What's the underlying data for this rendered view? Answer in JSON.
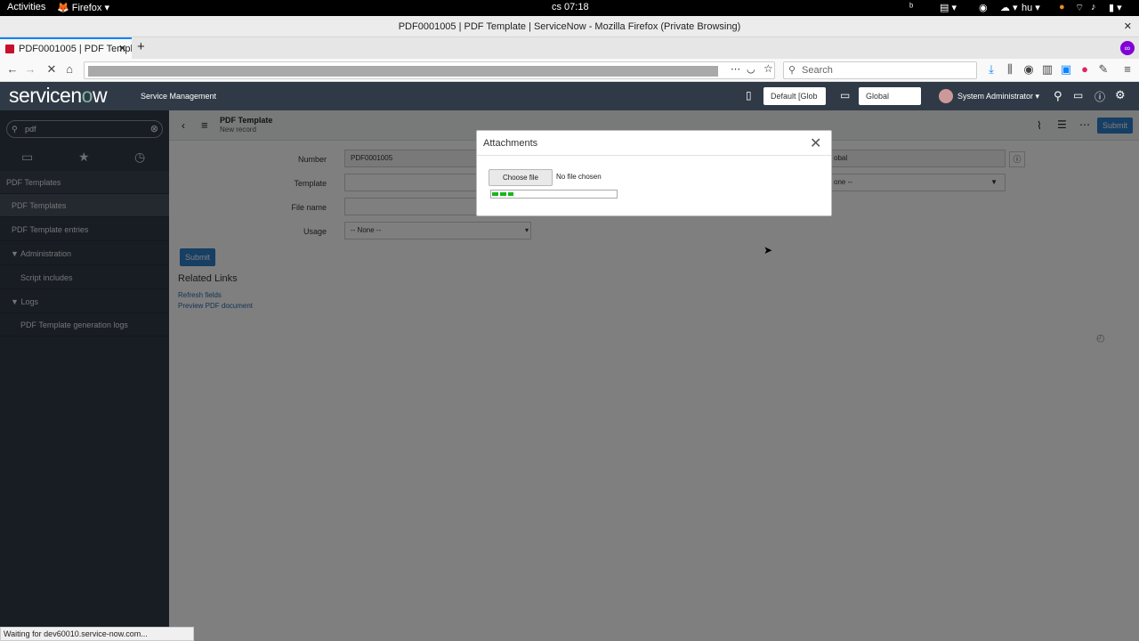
{
  "gnome": {
    "activities": "Activities",
    "app": "Firefox",
    "time": "cs 07:18",
    "lang": "hu"
  },
  "firefox": {
    "window_title": "PDF0001005 | PDF Template | ServiceNow - Mozilla Firefox (Private Browsing)",
    "tab_title": "PDF0001005 | PDF Templ",
    "search_placeholder": "Search",
    "status_text": "Waiting for dev60010.service-now.com..."
  },
  "sn_header": {
    "logo_text_a": "servicen",
    "logo_text_o": "o",
    "logo_text_b": "w",
    "subtitle": "Service Management",
    "update_set": "Default [Glob",
    "scope": "Global",
    "user": "System Administrator"
  },
  "sidebar": {
    "filter_value": "pdf",
    "section_title": "PDF Templates",
    "items": [
      {
        "label": "PDF Templates"
      },
      {
        "label": "PDF Template entries"
      },
      {
        "label": "Administration"
      },
      {
        "label": "Script includes"
      },
      {
        "label": "Logs"
      },
      {
        "label": "PDF Template generation logs"
      }
    ]
  },
  "form": {
    "header_title": "PDF Template",
    "header_subtitle": "New record",
    "submit_label": "Submit",
    "labels": {
      "number": "Number",
      "template": "Template",
      "file_name": "File name",
      "usage": "Usage"
    },
    "values": {
      "number": "PDF0001005",
      "usage": "-- None --",
      "right_value": "obal",
      "right_select": "one --"
    },
    "related_links_title": "Related Links",
    "links": [
      "Refresh fields",
      "Preview PDF document"
    ]
  },
  "modal": {
    "title": "Attachments",
    "choose_file": "Choose file",
    "no_file": "No file chosen",
    "progress": 0.17
  },
  "colors": {
    "sn_header": "#303a46",
    "accent_blue": "#2f7dc6",
    "progress_green": "#17b71d"
  }
}
